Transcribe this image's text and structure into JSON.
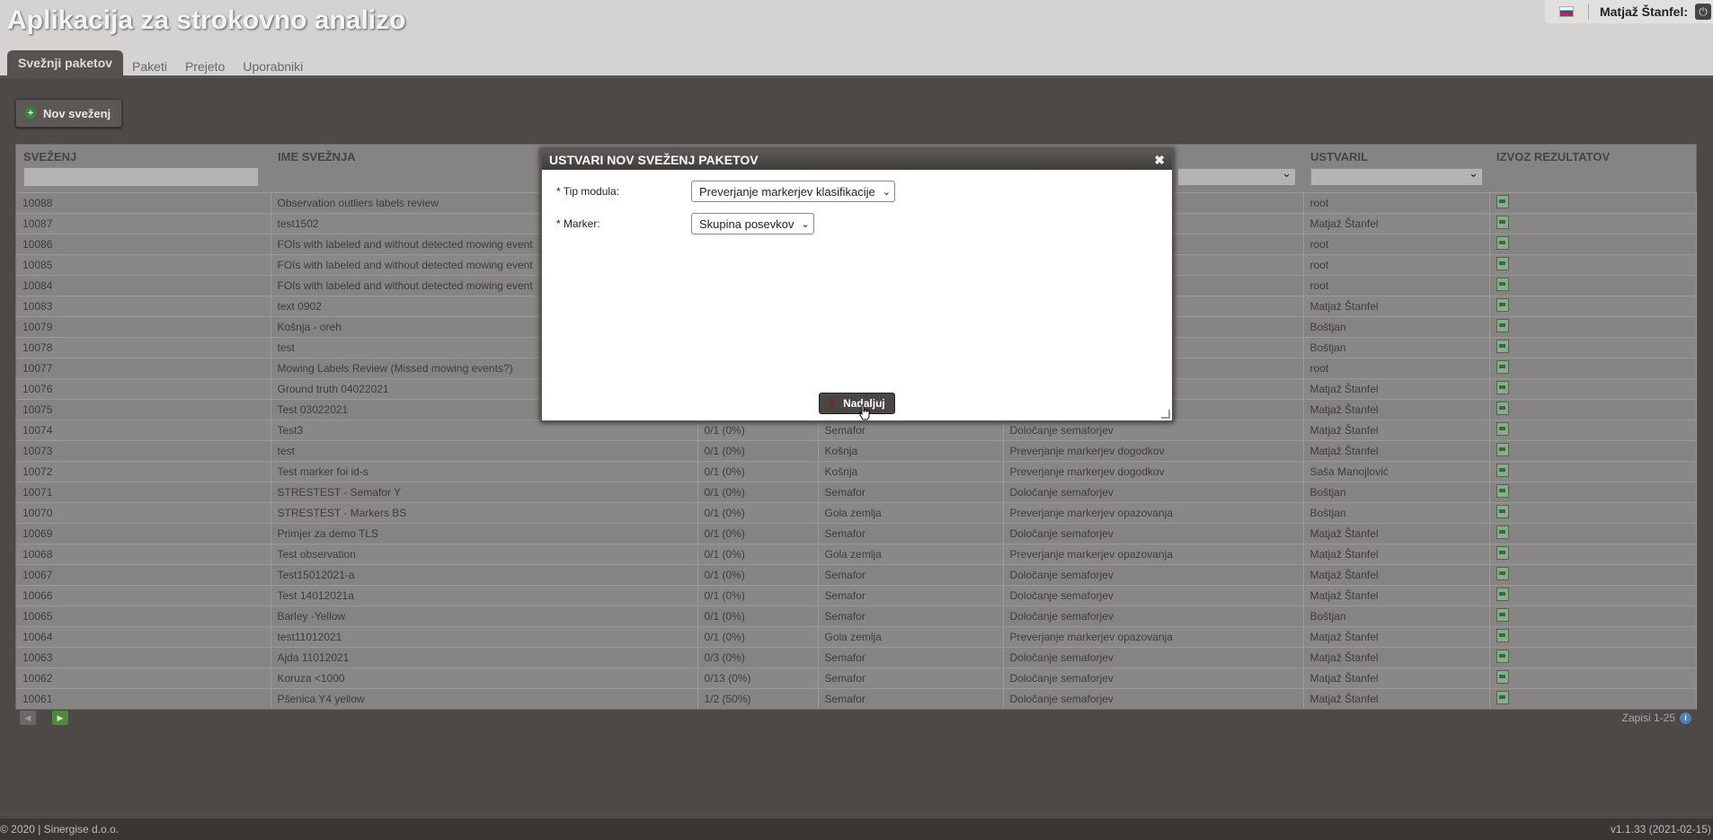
{
  "app": {
    "title": "Aplikacija za strokovno analizo",
    "user": "Matjaž Štanfel:"
  },
  "tabs": [
    "Svežnji paketov",
    "Paketi",
    "Prejeto",
    "Uporabniki"
  ],
  "toolbar": {
    "new_label": "Nov sveženj"
  },
  "table": {
    "headers": [
      "SVEŽENJ",
      "IME SVEŽNJA",
      "",
      "",
      "",
      "USTVARIL",
      "IZVOZ REZULTATOV"
    ],
    "rows": [
      [
        "10088",
        "Observation outliers labels review",
        "",
        "",
        "",
        "root"
      ],
      [
        "10087",
        "test1502",
        "",
        "",
        "",
        "Matjaž Štanfel"
      ],
      [
        "10086",
        "FOIs with labeled and without detected mowing event",
        "",
        "",
        "",
        "root"
      ],
      [
        "10085",
        "FOIs with labeled and without detected mowing event",
        "",
        "",
        "",
        "root"
      ],
      [
        "10084",
        "FOIs with labeled and without detected mowing event",
        "",
        "",
        "",
        "root"
      ],
      [
        "10083",
        "text 0902",
        "",
        "",
        "",
        "Matjaž Štanfel"
      ],
      [
        "10079",
        "Košnja - oreh",
        "",
        "",
        "",
        "Boštjan"
      ],
      [
        "10078",
        "test",
        "",
        "",
        "",
        "Boštjan"
      ],
      [
        "10077",
        "Mowing Labels Review (Missed mowing events?)",
        "",
        "",
        "",
        "root"
      ],
      [
        "10076",
        "Ground truth 04022021",
        "",
        "",
        "",
        "Matjaž Štanfel"
      ],
      [
        "10075",
        "Test 03022021",
        "",
        "",
        "",
        "Matjaž Štanfel"
      ],
      [
        "10074",
        "Test3",
        "0/1 (0%)",
        "Semafor",
        "Določanje semaforjev",
        "Matjaž Štanfel"
      ],
      [
        "10073",
        "test",
        "0/1 (0%)",
        "Košnja",
        "Preverjanje markerjev dogodkov",
        "Matjaž Štanfel"
      ],
      [
        "10072",
        "Test marker foi id-s",
        "0/1 (0%)",
        "Košnja",
        "Preverjanje markerjev dogodkov",
        "Saša Manojlović"
      ],
      [
        "10071",
        "STRESTEST - Semafor Y",
        "0/1 (0%)",
        "Semafor",
        "Določanje semaforjev",
        "Boštjan"
      ],
      [
        "10070",
        "STRESTEST - Markers BS",
        "0/1 (0%)",
        "Gola zemlja",
        "Preverjanje markerjev opazovanja",
        "Boštjan"
      ],
      [
        "10069",
        "Primjer za demo TLS",
        "0/1 (0%)",
        "Semafor",
        "Določanje semaforjev",
        "Matjaž Štanfel"
      ],
      [
        "10068",
        "Test observation",
        "0/1 (0%)",
        "Gola zemlja",
        "Preverjanje markerjev opazovanja",
        "Matjaž Štanfel"
      ],
      [
        "10067",
        "Test15012021-a",
        "0/1 (0%)",
        "Semafor",
        "Določanje semaforjev",
        "Matjaž Štanfel"
      ],
      [
        "10066",
        "Test 14012021a",
        "0/1 (0%)",
        "Semafor",
        "Določanje semaforjev",
        "Matjaž Štanfel"
      ],
      [
        "10065",
        "Barley -Yellow",
        "0/1 (0%)",
        "Semafor",
        "Določanje semaforjev",
        "Boštjan"
      ],
      [
        "10064",
        "test11012021",
        "0/1 (0%)",
        "Gola zemlja",
        "Preverjanje markerjev opazovanja",
        "Matjaž Štanfel"
      ],
      [
        "10063",
        "Ajda 11012021",
        "0/3 (0%)",
        "Semafor",
        "Določanje semaforjev",
        "Matjaž Štanfel"
      ],
      [
        "10062",
        "Koruza <1000",
        "0/13 (0%)",
        "Semafor",
        "Določanje semaforjev",
        "Matjaž Štanfel"
      ],
      [
        "10061",
        "Pšenica Y4 yellow",
        "1/2 (50%)",
        "Semafor",
        "Določanje semaforjev",
        "Matjaž Štanfel"
      ]
    ]
  },
  "pager": {
    "records": "Zapisi 1-25"
  },
  "modal": {
    "title": "USTVARI NOV SVEŽENJ PAKETOV",
    "tip_label": "* Tip modula:",
    "tip_value": "Preverjanje markerjev klasifikacije",
    "marker_label": "* Marker:",
    "marker_value": "Skupina posevkov",
    "continue_label": "Nadaljuj"
  },
  "footer": {
    "left": "© 2020 | Sinergise d.o.o.",
    "right": "v1.1.33 (2021-02-15)"
  }
}
